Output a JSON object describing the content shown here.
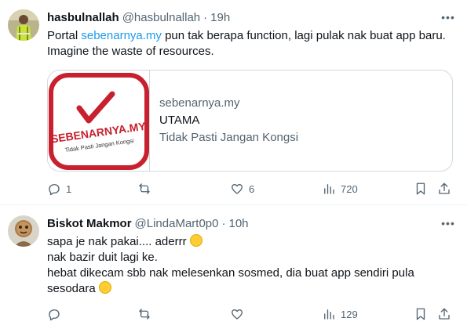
{
  "tweets": [
    {
      "name": "hasbulnallah",
      "handle": "@hasbulnallah",
      "separator": "·",
      "time": "19h",
      "text_pre": "Portal ",
      "text_link": "sebenarnya.my",
      "text_post": " pun tak berapa function, lagi pulak nak buat app baru. Imagine the waste of resources.",
      "card": {
        "logo_text_1": "SEBENARNYA.MY",
        "logo_text_2": "Tidak Pasti Jangan Kongsi",
        "domain": "sebenarnya.my",
        "title": "UTAMA",
        "description": "Tidak Pasti Jangan Kongsi"
      },
      "replies": "1",
      "retweets": "",
      "likes": "6",
      "views": "720"
    },
    {
      "name": "Biskot Makmor",
      "handle": "@LindaMart0p0",
      "separator": "·",
      "time": "10h",
      "line1": "sapa je nak pakai.... aderrr",
      "line2": "nak bazir duit lagi ke.",
      "line3": "hebat dikecam sbb nak melesenkan sosmed, dia buat app sendiri pula",
      "line4": "sesodara",
      "replies": "",
      "retweets": "",
      "likes": "",
      "views": "129"
    }
  ],
  "colors": {
    "accent": "#1d9bf0",
    "muted": "#536471",
    "text": "#0f1419",
    "border": "#cfd9de",
    "logo_red": "#c8202f"
  },
  "icons": {
    "more": "more-horizontal-icon",
    "reply": "reply-icon",
    "retweet": "retweet-icon",
    "like": "heart-icon",
    "views": "views-chart-icon",
    "bookmark": "bookmark-icon",
    "share": "share-icon",
    "emoji1": "rofl-emoji",
    "emoji2": "shushing-face-emoji"
  }
}
